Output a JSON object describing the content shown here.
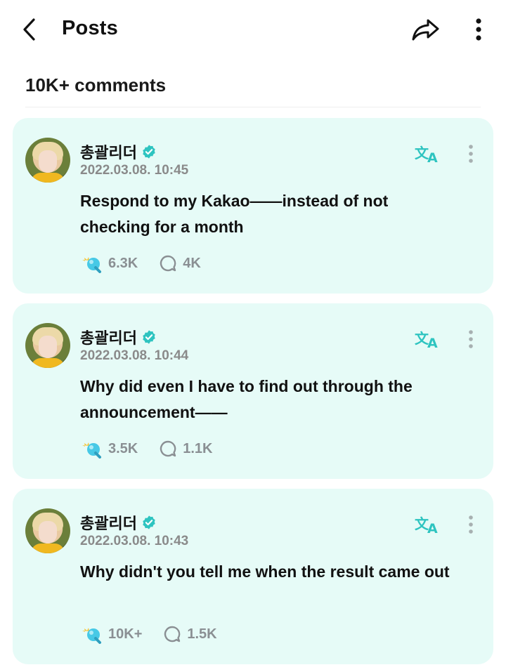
{
  "header": {
    "title": "Posts",
    "back_icon": "chevron-left-icon",
    "share_icon": "share-icon",
    "more_icon": "more-vertical-icon"
  },
  "comments_count": "10K+ comments",
  "colors": {
    "card_background": "#e6fbf7",
    "accent_teal": "#2ec4c0",
    "meta_grey": "#8a8a8a"
  },
  "comments": [
    {
      "author": "총괄리더",
      "date": "2022.03.08. 10:45",
      "text": "Respond to my Kakao——instead of not checking for a month",
      "likes": "6.3K",
      "replies": "4K"
    },
    {
      "author": "총괄리더",
      "date": "2022.03.08. 10:44",
      "text": "Why did even I have to find out through the announcement——",
      "likes": "3.5K",
      "replies": "1.1K"
    },
    {
      "author": "총괄리더",
      "date": "2022.03.08. 10:43",
      "text": "Why didn't you tell me when the result came out",
      "likes": "10K+",
      "replies": "1.5K"
    }
  ]
}
